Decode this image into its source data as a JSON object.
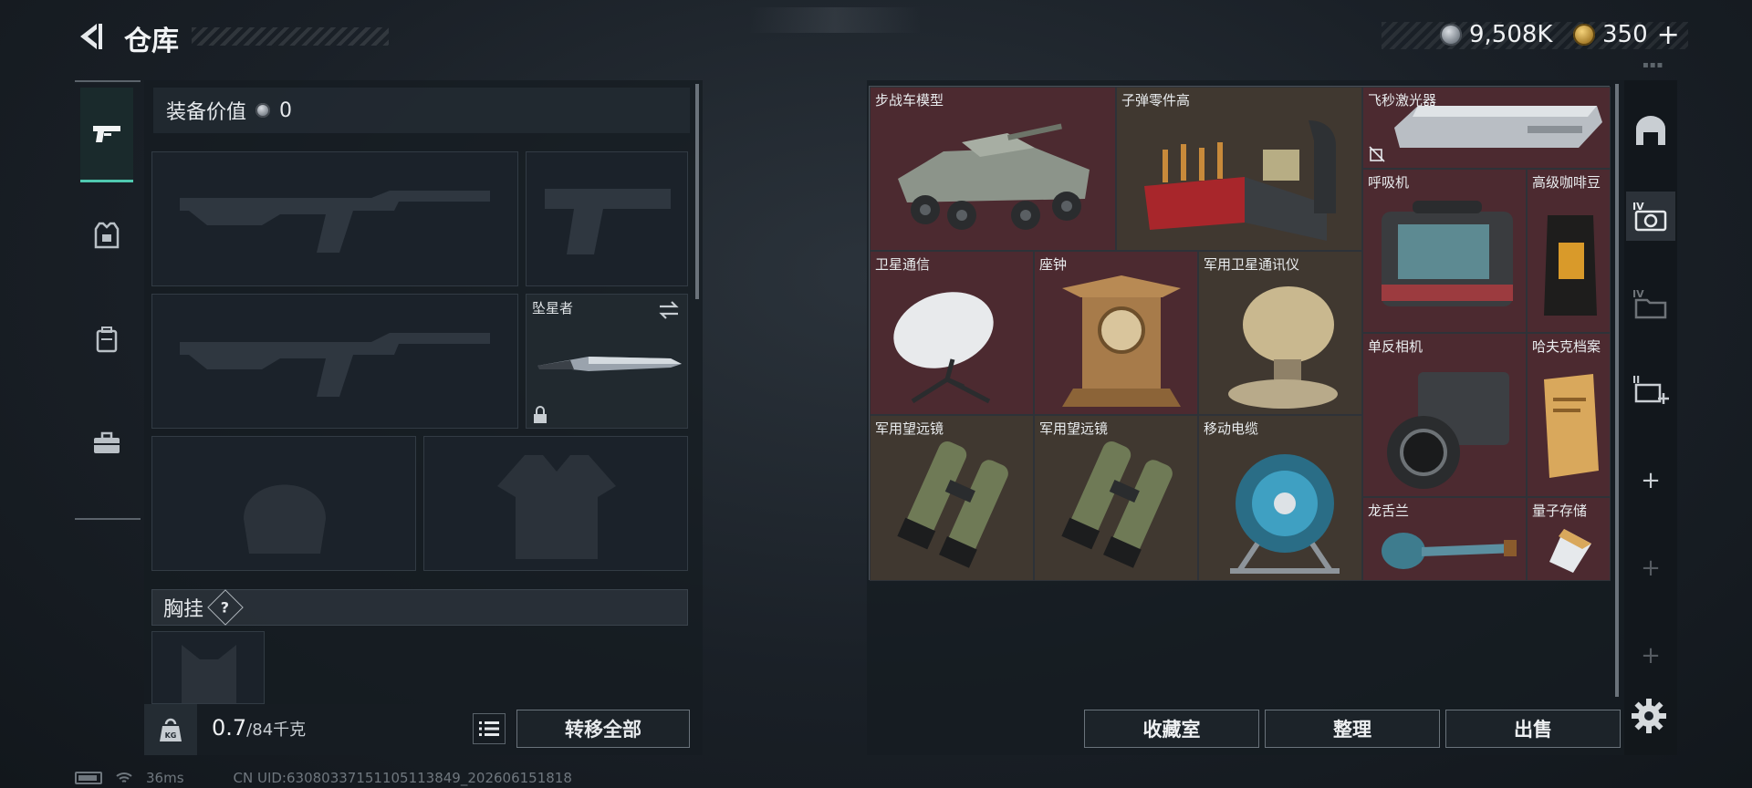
{
  "header": {
    "title": "仓库",
    "currency": {
      "coins": "9,508K",
      "tickets": "350"
    },
    "plus_label": "+"
  },
  "equipment": {
    "value_label": "装备价值",
    "value": "0",
    "melee_name": "坠星者",
    "chest_rig_label": "胸挂",
    "help_label": "?",
    "weight": {
      "current": "0.7",
      "max": "/84千克"
    },
    "transfer_all_label": "转移全部"
  },
  "storage": {
    "items": [
      {
        "id": "ifv-model",
        "label": "步战车模型"
      },
      {
        "id": "bullet-parts",
        "label": "子弹零件高"
      },
      {
        "id": "femto-laser",
        "label": "飞秒激光器"
      },
      {
        "id": "ventilator",
        "label": "呼吸机"
      },
      {
        "id": "coffee-beans",
        "label": "高级咖啡豆"
      },
      {
        "id": "sat-comm",
        "label": "卫星通信"
      },
      {
        "id": "clock",
        "label": "座钟"
      },
      {
        "id": "mil-sat-comm",
        "label": "军用卫星通讯仪"
      },
      {
        "id": "dslr",
        "label": "单反相机"
      },
      {
        "id": "hawk-file",
        "label": "哈夫克档案"
      },
      {
        "id": "binoculars-1",
        "label": "军用望远镜"
      },
      {
        "id": "binoculars-2",
        "label": "军用望远镜"
      },
      {
        "id": "cable-reel",
        "label": "移动电缆"
      },
      {
        "id": "agave",
        "label": "龙舌兰"
      },
      {
        "id": "quantum-storage",
        "label": "量子存储"
      }
    ],
    "buttons": {
      "collection": "收藏室",
      "arrange": "整理",
      "sell": "出售"
    }
  },
  "status": {
    "ping": "36ms",
    "uid": "CN UID:630803371511051138​49_202606151818"
  },
  "colors": {
    "accent": "#4fc9b0",
    "cell_red": "#4c2a30",
    "cell_brown": "#403830"
  }
}
